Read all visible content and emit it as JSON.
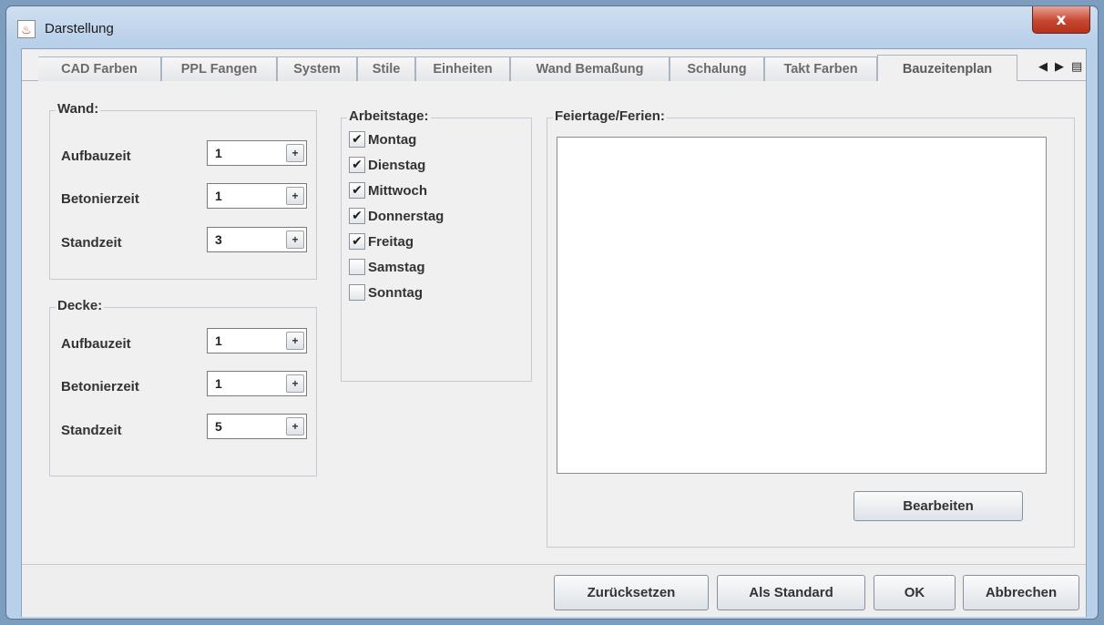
{
  "window": {
    "title": "Darstellung",
    "close_symbol": "x"
  },
  "tabs": [
    {
      "label": "CAD Farben",
      "active": false
    },
    {
      "label": "PPL Fangen",
      "active": false
    },
    {
      "label": "System",
      "active": false
    },
    {
      "label": "Stile",
      "active": false
    },
    {
      "label": "Einheiten",
      "active": false
    },
    {
      "label": "Wand Bemaßung",
      "active": false
    },
    {
      "label": "Schalung",
      "active": false
    },
    {
      "label": "Takt Farben",
      "active": false
    },
    {
      "label": "Bauzeitenplan",
      "active": true
    }
  ],
  "tab_nav": {
    "left": "◀",
    "right": "▶",
    "list": "▤"
  },
  "wand": {
    "title": "Wand:",
    "rows": [
      {
        "label": "Aufbauzeit",
        "value": "1"
      },
      {
        "label": "Betonierzeit",
        "value": "1"
      },
      {
        "label": "Standzeit",
        "value": "3"
      }
    ]
  },
  "decke": {
    "title": "Decke:",
    "rows": [
      {
        "label": "Aufbauzeit",
        "value": "1"
      },
      {
        "label": "Betonierzeit",
        "value": "1"
      },
      {
        "label": "Standzeit",
        "value": "5"
      }
    ]
  },
  "spinner_symbol": "+",
  "arbeitstage": {
    "title": "Arbeitstage:",
    "check_symbol": "✔",
    "days": [
      {
        "label": "Montag",
        "checked": true
      },
      {
        "label": "Dienstag",
        "checked": true
      },
      {
        "label": "Mittwoch",
        "checked": true
      },
      {
        "label": "Donnerstag",
        "checked": true
      },
      {
        "label": "Freitag",
        "checked": true
      },
      {
        "label": "Samstag",
        "checked": false
      },
      {
        "label": "Sonntag",
        "checked": false
      }
    ]
  },
  "feiertage": {
    "title": "Feiertage/Ferien:",
    "edit_button": "Bearbeiten"
  },
  "footer": {
    "reset": "Zurücksetzen",
    "default": "Als Standard",
    "ok": "OK",
    "cancel": "Abbrechen"
  }
}
